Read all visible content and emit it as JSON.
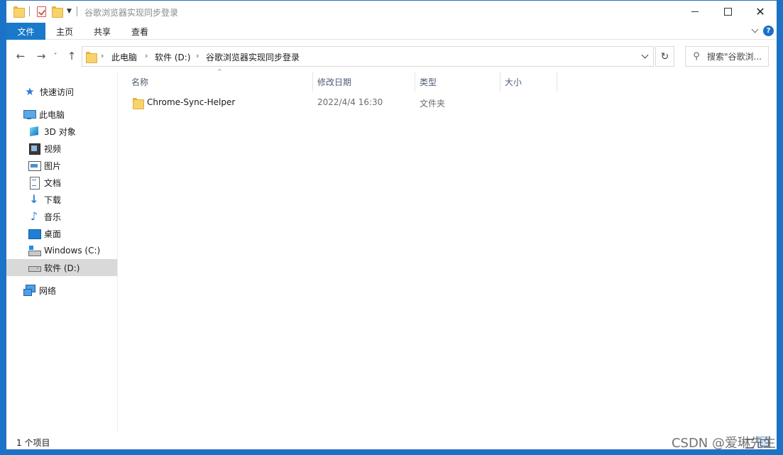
{
  "window": {
    "title": "谷歌浏览器实现同步登录",
    "controls": {
      "minimize_icon": "minimize-icon",
      "maximize_icon": "maximize-icon",
      "close_glyph": "✕"
    }
  },
  "ribbon": {
    "tabs": [
      {
        "label": "文件",
        "active": true
      },
      {
        "label": "主页"
      },
      {
        "label": "共享"
      },
      {
        "label": "查看"
      }
    ],
    "help_glyph": "?"
  },
  "nav": {
    "back_glyph": "←",
    "forward_glyph": "→",
    "recent_glyph": "˅",
    "up_glyph": "↑",
    "breadcrumb": [
      "此电脑",
      "软件 (D:)",
      "谷歌浏览器实现同步登录"
    ],
    "breadcrumb_sep": "›",
    "refresh_glyph": "↻",
    "search_placeholder": "搜索\"谷歌浏...",
    "search_glyph": "⚲"
  },
  "sidebar": {
    "items": [
      {
        "label": "快速访问",
        "icon": "quick-access-star-icon"
      },
      {
        "label": "此电脑",
        "icon": "this-pc-icon"
      },
      {
        "label": "3D 对象",
        "icon": "3d-objects-icon"
      },
      {
        "label": "视频",
        "icon": "videos-icon"
      },
      {
        "label": "图片",
        "icon": "pictures-icon"
      },
      {
        "label": "文档",
        "icon": "documents-icon"
      },
      {
        "label": "下载",
        "icon": "downloads-icon"
      },
      {
        "label": "音乐",
        "icon": "music-icon"
      },
      {
        "label": "桌面",
        "icon": "desktop-icon"
      },
      {
        "label": "Windows (C:)",
        "icon": "drive-c-icon"
      },
      {
        "label": "软件 (D:)",
        "icon": "drive-d-icon",
        "selected": true
      },
      {
        "label": "网络",
        "icon": "network-icon"
      }
    ],
    "glyphs": {
      "star": "★",
      "download": "↓",
      "music": "♪"
    }
  },
  "content": {
    "columns": [
      "名称",
      "修改日期",
      "类型",
      "大小"
    ],
    "sort_glyph": "^",
    "rows": [
      {
        "name": "Chrome-Sync-Helper",
        "modified": "2022/4/4 16:30",
        "type": "文件夹",
        "size": ""
      }
    ]
  },
  "status": {
    "item_count": "1 个项目"
  },
  "watermark": "CSDN @爱琳先生"
}
